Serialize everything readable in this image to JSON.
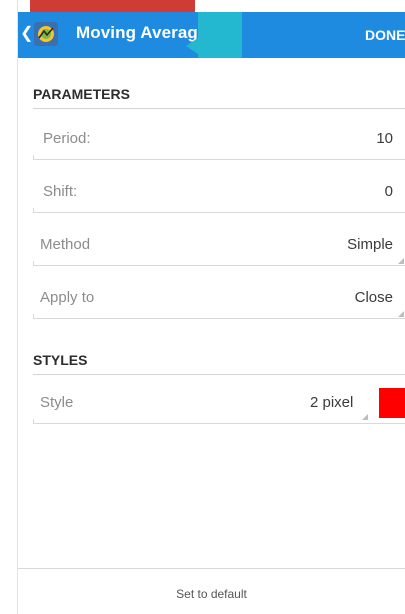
{
  "toolbar": {
    "title": "Moving Average",
    "done_label": "DONE",
    "back_icon": "chevron-left-icon",
    "app_icon": "metatrader-app-icon",
    "accent_color": "#1e8be0"
  },
  "parameters": {
    "header": "PARAMETERS",
    "period": {
      "label": "Period:",
      "value": "10"
    },
    "shift": {
      "label": "Shift:",
      "value": "0"
    },
    "method": {
      "label": "Method",
      "value": "Simple"
    },
    "apply_to": {
      "label": "Apply to",
      "value": "Close"
    }
  },
  "styles": {
    "header": "STYLES",
    "style": {
      "label": "Style",
      "value": "2 pixel",
      "color": "#ff0000"
    }
  },
  "footer": {
    "reset_label": "Set to default"
  }
}
